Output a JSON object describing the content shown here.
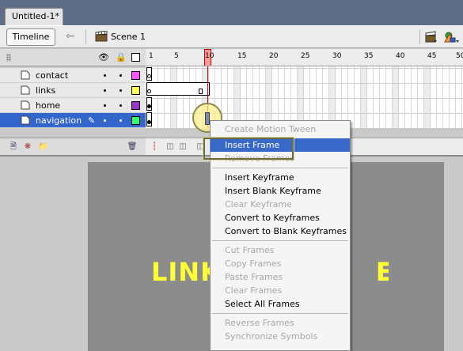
{
  "document": {
    "tab_title": "Untitled-1*"
  },
  "editbar": {
    "timeline_label": "Timeline",
    "scene_label": "Scene 1"
  },
  "ruler": {
    "labels": [
      "1",
      "5",
      "10",
      "15",
      "20",
      "25",
      "30",
      "35",
      "40",
      "45",
      "50"
    ],
    "current_frame": "10"
  },
  "layers": [
    {
      "name": "contact",
      "color": "#ff55ff"
    },
    {
      "name": "links",
      "color": "#ffff55"
    },
    {
      "name": "home",
      "color": "#9933cc"
    },
    {
      "name": "navigation",
      "color": "#33ff66",
      "selected": true
    }
  ],
  "stage": {
    "text": "LINK",
    "text_right": "ERE",
    "text_color": "#ffff33"
  },
  "context_menu": {
    "items": [
      {
        "label": "Create Motion Tween",
        "enabled": false
      },
      {
        "label": "Insert Frame",
        "enabled": true,
        "highlighted": true
      },
      {
        "label": "Remove Frames",
        "enabled": false
      },
      {
        "sep": true
      },
      {
        "label": "Insert Keyframe",
        "enabled": true
      },
      {
        "label": "Insert Blank Keyframe",
        "enabled": true
      },
      {
        "label": "Clear Keyframe",
        "enabled": false
      },
      {
        "label": "Convert to Keyframes",
        "enabled": true
      },
      {
        "label": "Convert to Blank Keyframes",
        "enabled": true
      },
      {
        "sep": true
      },
      {
        "label": "Cut Frames",
        "enabled": false
      },
      {
        "label": "Copy Frames",
        "enabled": false
      },
      {
        "label": "Paste Frames",
        "enabled": false
      },
      {
        "label": "Clear Frames",
        "enabled": false
      },
      {
        "label": "Select All Frames",
        "enabled": true
      },
      {
        "sep": true
      },
      {
        "label": "Reverse Frames",
        "enabled": false
      },
      {
        "label": "Synchronize Symbols",
        "enabled": false
      }
    ]
  },
  "icons": {
    "back": "back-arrow-icon",
    "scene": "clapperboard-icon",
    "eye": "eye-icon",
    "lock": "lock-icon",
    "outline": "outline-square-icon",
    "layer": "layer-page-icon",
    "pencil": "pencil-icon",
    "trash": "trash-icon"
  }
}
